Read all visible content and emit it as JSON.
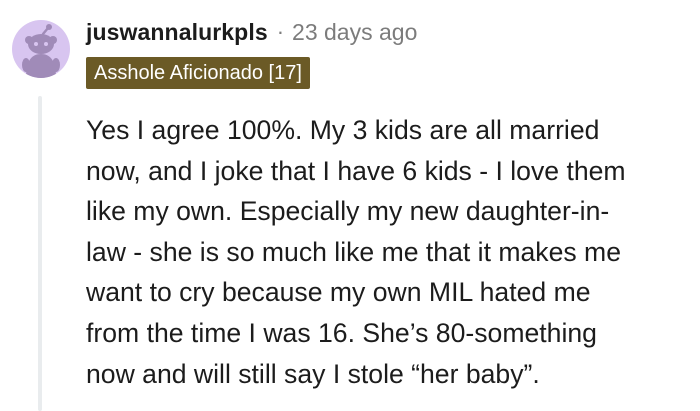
{
  "comment": {
    "username": "juswannalurkpls",
    "separator": "·",
    "timestamp": "23 days ago",
    "flair": "Asshole Aficionado [17]",
    "avatar_icon": "snoo-avatar-icon",
    "body_lines": [
      "Yes I agree 100%. My 3 kids are all married",
      "now, and I joke that I have 6 kids - I love them",
      "like my own. Especially my new daughter-in-",
      "law - she is so much like me that it makes me",
      "want to cry because my own MIL hated me",
      "from the time I was 16. She’s 80-something",
      "now and will still say I stole “her baby”."
    ]
  },
  "colors": {
    "avatar_bg": "#d8c5f0",
    "avatar_figure": "#a08bb8",
    "flair_bg": "#6b5a26",
    "flair_text": "#ffffff",
    "meta_gray": "#7c7c7c",
    "text": "#1c1c1c",
    "thread_line": "#e9ecee"
  }
}
